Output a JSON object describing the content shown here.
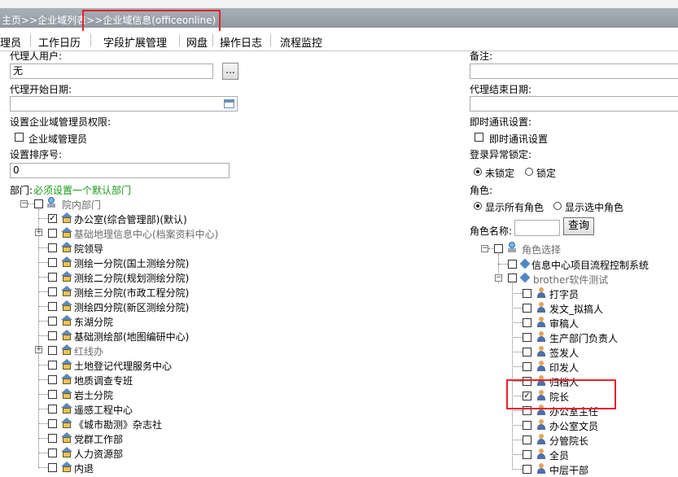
{
  "breadcrumb": {
    "home": "主页",
    "sep1": ">>",
    "list": "企业域列表",
    "sep2": ">>",
    "current": "企业域信息(officeonline)"
  },
  "menu": [
    "理员",
    "工作日历",
    "字段扩展管理",
    "网盘",
    "操作日志",
    "流程监控"
  ],
  "left": {
    "agent_user_label": "代理人用户:",
    "agent_user_value": "无",
    "agent_btn": "...",
    "agent_start_label": "代理开始日期:",
    "admin_perm_label": "设置企业域管理员权限:",
    "admin_checkbox_label": "企业域管理员",
    "sort_label": "设置排序号:",
    "sort_value": "0",
    "dept_label": "部门:",
    "dept_hint": "必须设置一个默认部门",
    "dept_root": "院内部门",
    "departments": [
      {
        "name": "办公室(综合管理部)(默认)",
        "checked": true,
        "expandable": false,
        "gray": false
      },
      {
        "name": "基础地理信息中心(档案资料中心)",
        "checked": false,
        "expandable": true,
        "gray": true
      },
      {
        "name": "院领导",
        "checked": false,
        "expandable": false,
        "gray": false
      },
      {
        "name": "测绘一分院(国土测绘分院)",
        "checked": false,
        "expandable": false,
        "gray": false
      },
      {
        "name": "测绘二分院(规划测绘分院)",
        "checked": false,
        "expandable": false,
        "gray": false
      },
      {
        "name": "测绘三分院(市政工程分院)",
        "checked": false,
        "expandable": false,
        "gray": false
      },
      {
        "name": "测绘四分院(新区测绘分院)",
        "checked": false,
        "expandable": false,
        "gray": false
      },
      {
        "name": "东湖分院",
        "checked": false,
        "expandable": false,
        "gray": false
      },
      {
        "name": "基础测绘部(地图编研中心)",
        "checked": false,
        "expandable": false,
        "gray": false
      },
      {
        "name": "红线办",
        "checked": false,
        "expandable": true,
        "gray": true
      },
      {
        "name": "土地登记代理服务中心",
        "checked": false,
        "expandable": false,
        "gray": false
      },
      {
        "name": "地质调查专班",
        "checked": false,
        "expandable": false,
        "gray": false
      },
      {
        "name": "岩土分院",
        "checked": false,
        "expandable": false,
        "gray": false
      },
      {
        "name": "遥感工程中心",
        "checked": false,
        "expandable": false,
        "gray": false
      },
      {
        "name": "《城市勘测》杂志社",
        "checked": false,
        "expandable": false,
        "gray": false
      },
      {
        "name": "党群工作部",
        "checked": false,
        "expandable": false,
        "gray": false
      },
      {
        "name": "人力资源部",
        "checked": false,
        "expandable": false,
        "gray": false
      },
      {
        "name": "内退",
        "checked": false,
        "expandable": false,
        "gray": false
      }
    ]
  },
  "right": {
    "remark_label": "备注:",
    "agent_end_label": "代理结束日期:",
    "im_label": "即时通讯设置:",
    "im_checkbox_label": "即时通讯设置",
    "lock_label": "登录异常锁定:",
    "unlocked_label": "未锁定",
    "locked_label": "锁定",
    "role_label": "角色:",
    "show_all_roles": "显示所有角色",
    "show_selected_roles": "显示选中角色",
    "role_name_label": "角色名称:",
    "query_btn": "查询",
    "role_root": "角色选择",
    "group1": "信息中心项目流程控制系统",
    "group2": "brother软件测试",
    "roles": [
      {
        "name": "打字员",
        "checked": false
      },
      {
        "name": "发文_拟搞人",
        "checked": false
      },
      {
        "name": "审稿人",
        "checked": false
      },
      {
        "name": "生产部门负责人",
        "checked": false
      },
      {
        "name": "签发人",
        "checked": false
      },
      {
        "name": "印发人",
        "checked": false
      },
      {
        "name": "归档人",
        "checked": false
      },
      {
        "name": "院长",
        "checked": true
      },
      {
        "name": "办公室主任",
        "checked": false
      },
      {
        "name": "办公室文员",
        "checked": false
      },
      {
        "name": "分管院长",
        "checked": false
      },
      {
        "name": "全员",
        "checked": false
      },
      {
        "name": "中层干部",
        "checked": false
      }
    ]
  }
}
